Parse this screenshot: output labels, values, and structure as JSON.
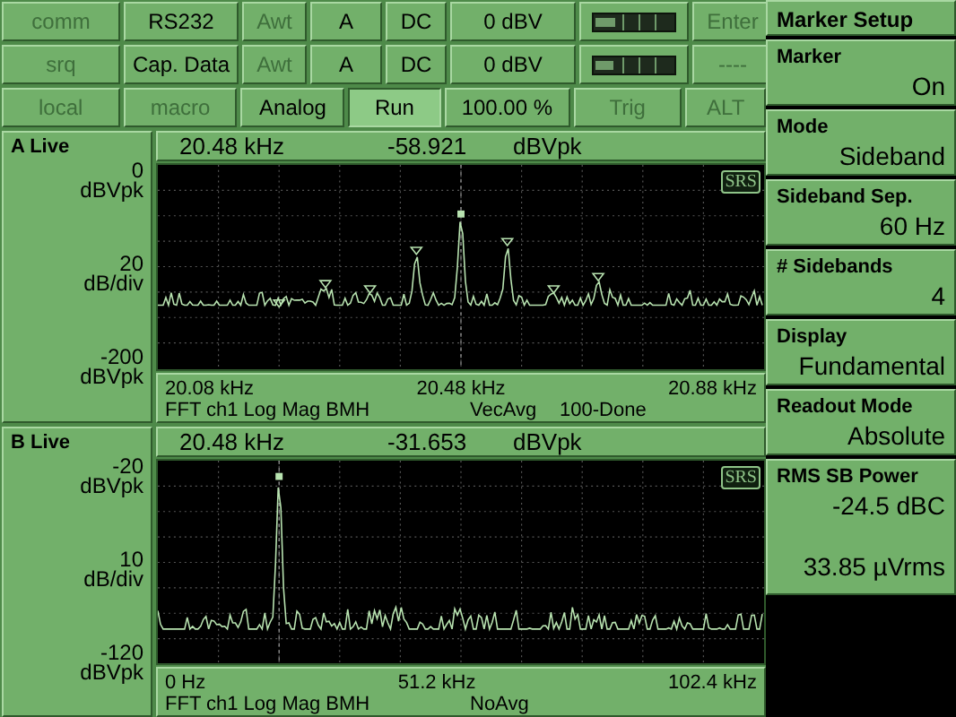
{
  "toolbar": {
    "rows": [
      [
        {
          "kind": "button",
          "label": "comm",
          "disabled": true
        },
        {
          "kind": "button",
          "label": "RS232",
          "disabled": false
        },
        {
          "kind": "button",
          "label": "Awt",
          "disabled": true
        },
        {
          "kind": "button",
          "label": "A",
          "disabled": false
        },
        {
          "kind": "button",
          "label": "DC",
          "disabled": false
        },
        {
          "kind": "button",
          "label": "0 dBV",
          "disabled": false
        },
        {
          "kind": "meter",
          "level": 0.25
        },
        {
          "kind": "button",
          "label": "Enter",
          "disabled": true
        }
      ],
      [
        {
          "kind": "button",
          "label": "srq",
          "disabled": true
        },
        {
          "kind": "button",
          "label": "Cap. Data",
          "disabled": false
        },
        {
          "kind": "button",
          "label": "Awt",
          "disabled": true
        },
        {
          "kind": "button",
          "label": "A",
          "disabled": false
        },
        {
          "kind": "button",
          "label": "DC",
          "disabled": false
        },
        {
          "kind": "button",
          "label": "0 dBV",
          "disabled": false
        },
        {
          "kind": "meter",
          "level": 0.22
        },
        {
          "kind": "button",
          "label": "----",
          "disabled": true
        }
      ]
    ]
  },
  "control_bar": [
    {
      "label": "local",
      "disabled": true
    },
    {
      "label": "macro",
      "disabled": true
    },
    {
      "label": "Analog",
      "disabled": false
    },
    {
      "label": "Run",
      "disabled": false,
      "selected": true
    },
    {
      "label": "100.00 %",
      "disabled": false
    },
    {
      "label": "Trig",
      "disabled": true
    },
    {
      "label": "ALT",
      "disabled": true
    }
  ],
  "traces": [
    {
      "kind": "sidebands",
      "title": "A Live",
      "frequency": "20.48 kHz",
      "amplitude": "-58.921",
      "unit": "dBVpk",
      "axis": [
        [
          "0",
          "dBVpk"
        ],
        [
          "20",
          "dB/div"
        ],
        [
          "-200",
          "dBVpk"
        ]
      ],
      "badge": "SRS",
      "x_labels": [
        "20.08 kHz",
        "20.48 kHz",
        "20.88 kHz"
      ],
      "info": [
        "FFT ch1 Log Mag BMH",
        "VecAvg",
        "100-Done"
      ]
    },
    {
      "kind": "single",
      "title": "B Live",
      "frequency": "20.48 kHz",
      "amplitude": "-31.653",
      "unit": "dBVpk",
      "axis": [
        [
          "-20",
          "dBVpk"
        ],
        [
          "10",
          "dB/div"
        ],
        [
          "-120",
          "dBVpk"
        ]
      ],
      "badge": "SRS",
      "x_labels": [
        "0 Hz",
        "51.2 kHz",
        "102.4 kHz"
      ],
      "info": [
        "FFT ch1 Log Mag BMH",
        "NoAvg"
      ]
    }
  ],
  "menu": {
    "title": "Marker Setup",
    "items": [
      {
        "kind": "setting",
        "label": "Marker",
        "values": [
          "On"
        ]
      },
      {
        "kind": "setting",
        "label": "Mode",
        "values": [
          "Sideband"
        ]
      },
      {
        "kind": "setting",
        "label": "Sideband Sep.",
        "values": [
          "60 Hz"
        ]
      },
      {
        "kind": "setting",
        "label": "# Sidebands",
        "values": [
          "4"
        ]
      },
      {
        "kind": "setting",
        "label": "Display",
        "values": [
          "Fundamental"
        ]
      },
      {
        "kind": "setting",
        "label": "Readout Mode",
        "values": [
          "Absolute"
        ]
      },
      {
        "kind": "readout",
        "label": "RMS SB Power",
        "values": [
          "-24.5 dBC",
          "33.85 µVrms"
        ]
      }
    ]
  }
}
